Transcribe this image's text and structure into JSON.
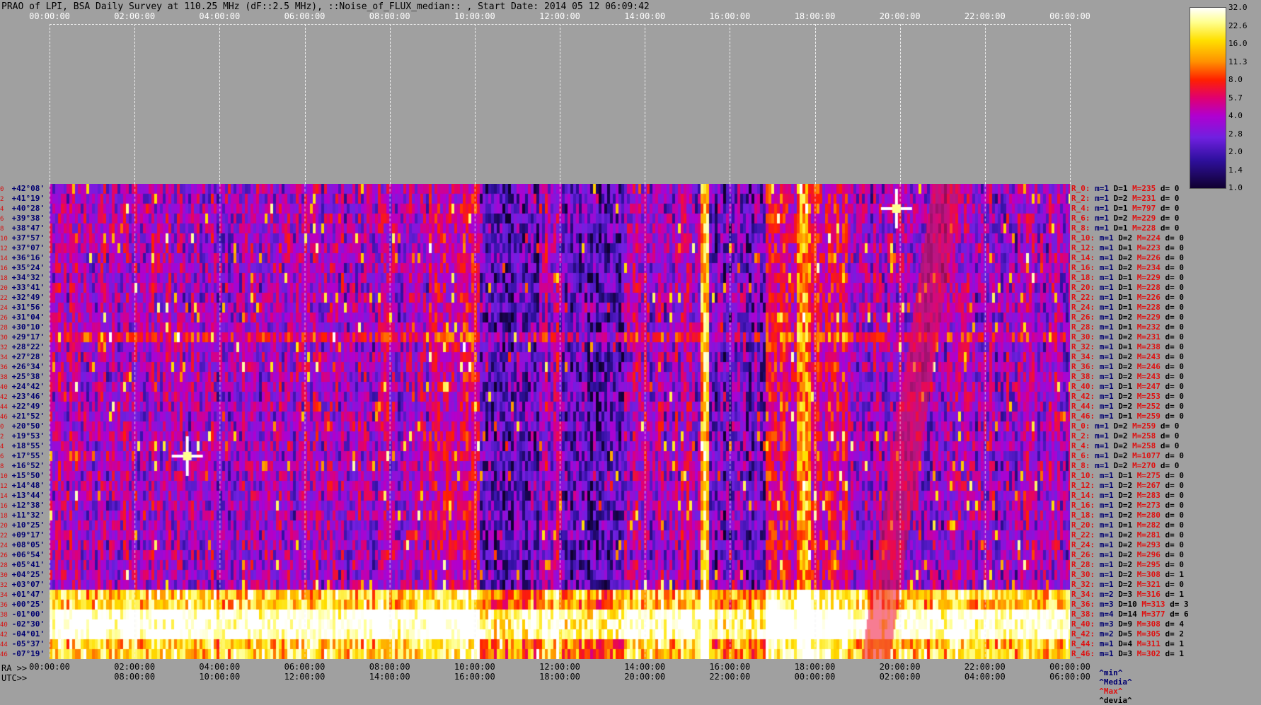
{
  "title": "PRAO of LPI, BSA Daily Survey at 110.25 MHz (dF::2.5 MHz), ::Noise_of_FLUX_median:: , Start Date: 2014 05 12 06:09:42",
  "utc_top_ticks": [
    "00:00:00",
    "02:00:00",
    "04:00:00",
    "06:00:00",
    "08:00:00",
    "10:00:00",
    "12:00:00",
    "14:00:00",
    "16:00:00",
    "18:00:00",
    "20:00:00",
    "22:00:00",
    "00:00:00"
  ],
  "ra_ticks": [
    "00:00:00",
    "02:00:00",
    "04:00:00",
    "06:00:00",
    "08:00:00",
    "10:00:00",
    "12:00:00",
    "14:00:00",
    "16:00:00",
    "18:00:00",
    "20:00:00",
    "22:00:00",
    "00:00:00"
  ],
  "utc_bottom_ticks": [
    "08:00:00",
    "10:00:00",
    "12:00:00",
    "14:00:00",
    "16:00:00",
    "18:00:00",
    "20:00:00",
    "22:00:00",
    "00:00:00",
    "02:00:00",
    "04:00:00",
    "06:00:00"
  ],
  "ra_label": "RA >>",
  "utc_label": "UTC>>",
  "legend_foot": {
    "min": "^min^",
    "media": "^Media^",
    "max": "^Max^",
    "devia": "^devia^"
  },
  "colorbar": {
    "labels": [
      "32.0",
      "22.6",
      "16.0",
      "11.3",
      "8.0",
      "5.7",
      "4.0",
      "2.8",
      "2.0",
      "1.4",
      "1.0"
    ],
    "colors": [
      "#ffffff",
      "#ffff90",
      "#ffe000",
      "#ff9000",
      "#ff2000",
      "#e00070",
      "#b000d0",
      "#7020e0",
      "#3010a0",
      "#100030"
    ]
  },
  "declinations": [
    {
      "i": "0",
      "d": "+42°08'"
    },
    {
      "i": "2",
      "d": "+41°19'"
    },
    {
      "i": "4",
      "d": "+40°28'"
    },
    {
      "i": "6",
      "d": "+39°38'"
    },
    {
      "i": "8",
      "d": "+38°47'"
    },
    {
      "i": "10",
      "d": "+37°57'"
    },
    {
      "i": "12",
      "d": "+37°07'"
    },
    {
      "i": "14",
      "d": "+36°16'"
    },
    {
      "i": "16",
      "d": "+35°24'"
    },
    {
      "i": "18",
      "d": "+34°32'"
    },
    {
      "i": "20",
      "d": "+33°41'"
    },
    {
      "i": "22",
      "d": "+32°49'"
    },
    {
      "i": "24",
      "d": "+31°56'"
    },
    {
      "i": "26",
      "d": "+31°04'"
    },
    {
      "i": "28",
      "d": "+30°10'"
    },
    {
      "i": "30",
      "d": "+29°17'"
    },
    {
      "i": "32",
      "d": "+28°22'"
    },
    {
      "i": "34",
      "d": "+27°28'"
    },
    {
      "i": "36",
      "d": "+26°34'"
    },
    {
      "i": "38",
      "d": "+25°38'"
    },
    {
      "i": "40",
      "d": "+24°42'"
    },
    {
      "i": "42",
      "d": "+23°46'"
    },
    {
      "i": "44",
      "d": "+22°49'"
    },
    {
      "i": "46",
      "d": "+21°52'"
    },
    {
      "i": "0",
      "d": "+20°50'"
    },
    {
      "i": "2",
      "d": "+19°53'"
    },
    {
      "i": "4",
      "d": "+18°55'"
    },
    {
      "i": "6",
      "d": "+17°55'"
    },
    {
      "i": "8",
      "d": "+16°52'"
    },
    {
      "i": "10",
      "d": "+15°50'"
    },
    {
      "i": "12",
      "d": "+14°48'"
    },
    {
      "i": "14",
      "d": "+13°44'"
    },
    {
      "i": "16",
      "d": "+12°38'"
    },
    {
      "i": "18",
      "d": "+11°32'"
    },
    {
      "i": "20",
      "d": "+10°25'"
    },
    {
      "i": "22",
      "d": "+09°17'"
    },
    {
      "i": "24",
      "d": "+08°05'"
    },
    {
      "i": "26",
      "d": "+06°54'"
    },
    {
      "i": "28",
      "d": "+05°41'"
    },
    {
      "i": "30",
      "d": "+04°25'"
    },
    {
      "i": "32",
      "d": "+03°07'"
    },
    {
      "i": "34",
      "d": "+01°47'"
    },
    {
      "i": "36",
      "d": "+00°25'"
    },
    {
      "i": "38",
      "d": "-01°00'"
    },
    {
      "i": "40",
      "d": "-02°30'"
    },
    {
      "i": "42",
      "d": "-04°01'"
    },
    {
      "i": "44",
      "d": "-05°37'"
    },
    {
      "i": "46",
      "d": "-07°19'"
    }
  ],
  "stats": [
    {
      "r": "R_0:",
      "m": "m=1",
      "D": "D=1",
      "M": "M=235",
      "d": "d= 0"
    },
    {
      "r": "R_2:",
      "m": "m=1",
      "D": "D=2",
      "M": "M=231",
      "d": "d= 0"
    },
    {
      "r": "R_4:",
      "m": "m=1",
      "D": "D=1",
      "M": "M=797",
      "d": "d= 0"
    },
    {
      "r": "R_6:",
      "m": "m=1",
      "D": "D=2",
      "M": "M=229",
      "d": "d= 0"
    },
    {
      "r": "R_8:",
      "m": "m=1",
      "D": "D=1",
      "M": "M=228",
      "d": "d= 0"
    },
    {
      "r": "R_10:",
      "m": "m=1",
      "D": "D=2",
      "M": "M=224",
      "d": "d= 0"
    },
    {
      "r": "R_12:",
      "m": "m=1",
      "D": "D=1",
      "M": "M=223",
      "d": "d= 0"
    },
    {
      "r": "R_14:",
      "m": "m=1",
      "D": "D=2",
      "M": "M=226",
      "d": "d= 0"
    },
    {
      "r": "R_16:",
      "m": "m=1",
      "D": "D=2",
      "M": "M=234",
      "d": "d= 0"
    },
    {
      "r": "R_18:",
      "m": "m=1",
      "D": "D=1",
      "M": "M=229",
      "d": "d= 0"
    },
    {
      "r": "R_20:",
      "m": "m=1",
      "D": "D=1",
      "M": "M=228",
      "d": "d= 0"
    },
    {
      "r": "R_22:",
      "m": "m=1",
      "D": "D=1",
      "M": "M=226",
      "d": "d= 0"
    },
    {
      "r": "R_24:",
      "m": "m=1",
      "D": "D=1",
      "M": "M=228",
      "d": "d= 0"
    },
    {
      "r": "R_26:",
      "m": "m=1",
      "D": "D=2",
      "M": "M=229",
      "d": "d= 0"
    },
    {
      "r": "R_28:",
      "m": "m=1",
      "D": "D=1",
      "M": "M=232",
      "d": "d= 0"
    },
    {
      "r": "R_30:",
      "m": "m=1",
      "D": "D=2",
      "M": "M=231",
      "d": "d= 0"
    },
    {
      "r": "R_32:",
      "m": "m=1",
      "D": "D=1",
      "M": "M=238",
      "d": "d= 0"
    },
    {
      "r": "R_34:",
      "m": "m=1",
      "D": "D=2",
      "M": "M=243",
      "d": "d= 0"
    },
    {
      "r": "R_36:",
      "m": "m=1",
      "D": "D=2",
      "M": "M=246",
      "d": "d= 0"
    },
    {
      "r": "R_38:",
      "m": "m=1",
      "D": "D=2",
      "M": "M=243",
      "d": "d= 0"
    },
    {
      "r": "R_40:",
      "m": "m=1",
      "D": "D=1",
      "M": "M=247",
      "d": "d= 0"
    },
    {
      "r": "R_42:",
      "m": "m=1",
      "D": "D=2",
      "M": "M=253",
      "d": "d= 0"
    },
    {
      "r": "R_44:",
      "m": "m=1",
      "D": "D=2",
      "M": "M=252",
      "d": "d= 0"
    },
    {
      "r": "R_46:",
      "m": "m=1",
      "D": "D=1",
      "M": "M=259",
      "d": "d= 0"
    },
    {
      "r": "R_0:",
      "m": "m=1",
      "D": "D=2",
      "M": "M=259",
      "d": "d= 0"
    },
    {
      "r": "R_2:",
      "m": "m=1",
      "D": "D=2",
      "M": "M=258",
      "d": "d= 0"
    },
    {
      "r": "R_4:",
      "m": "m=1",
      "D": "D=2",
      "M": "M=258",
      "d": "d= 0"
    },
    {
      "r": "R_6:",
      "m": "m=1",
      "D": "D=2",
      "M": "M=1077",
      "d": "d= 0"
    },
    {
      "r": "R_8:",
      "m": "m=1",
      "D": "D=2",
      "M": "M=270",
      "d": "d= 0"
    },
    {
      "r": "R_10:",
      "m": "m=1",
      "D": "D=1",
      "M": "M=275",
      "d": "d= 0"
    },
    {
      "r": "R_12:",
      "m": "m=1",
      "D": "D=2",
      "M": "M=267",
      "d": "d= 0"
    },
    {
      "r": "R_14:",
      "m": "m=1",
      "D": "D=2",
      "M": "M=283",
      "d": "d= 0"
    },
    {
      "r": "R_16:",
      "m": "m=1",
      "D": "D=2",
      "M": "M=273",
      "d": "d= 0"
    },
    {
      "r": "R_18:",
      "m": "m=1",
      "D": "D=2",
      "M": "M=280",
      "d": "d= 0"
    },
    {
      "r": "R_20:",
      "m": "m=1",
      "D": "D=1",
      "M": "M=282",
      "d": "d= 0"
    },
    {
      "r": "R_22:",
      "m": "m=1",
      "D": "D=2",
      "M": "M=281",
      "d": "d= 0"
    },
    {
      "r": "R_24:",
      "m": "m=1",
      "D": "D=2",
      "M": "M=293",
      "d": "d= 0"
    },
    {
      "r": "R_26:",
      "m": "m=1",
      "D": "D=2",
      "M": "M=296",
      "d": "d= 0"
    },
    {
      "r": "R_28:",
      "m": "m=1",
      "D": "D=2",
      "M": "M=295",
      "d": "d= 0"
    },
    {
      "r": "R_30:",
      "m": "m=1",
      "D": "D=2",
      "M": "M=308",
      "d": "d= 1"
    },
    {
      "r": "R_32:",
      "m": "m=1",
      "D": "D=2",
      "M": "M=321",
      "d": "d= 0"
    },
    {
      "r": "R_34:",
      "m": "m=2",
      "D": "D=3",
      "M": "M=316",
      "d": "d= 1"
    },
    {
      "r": "R_36:",
      "m": "m=3",
      "D": "D=10",
      "M": "M=313",
      "d": "d= 3"
    },
    {
      "r": "R_38:",
      "m": "m=4",
      "D": "D=14",
      "M": "M=377",
      "d": "d= 6"
    },
    {
      "r": "R_40:",
      "m": "m=3",
      "D": "D=9",
      "M": "M=308",
      "d": "d= 4"
    },
    {
      "r": "R_42:",
      "m": "m=2",
      "D": "D=5",
      "M": "M=305",
      "d": "d= 2"
    },
    {
      "r": "R_44:",
      "m": "m=1",
      "D": "D=4",
      "M": "M=311",
      "d": "d= 1"
    },
    {
      "r": "R_46:",
      "m": "m=1",
      "D": "D=3",
      "M": "M=302",
      "d": "d= 1"
    }
  ],
  "chart_data": {
    "type": "heatmap",
    "title": "PRAO of LPI, BSA Daily Survey at 110.25 MHz (dF::2.5 MHz), ::Noise_of_FLUX_median:: , Start Date: 2014 05 12 06:09:42",
    "xlabel": "RA / UTC",
    "ylabel": "",
    "x_range_ra": [
      "00:00:00",
      "24:00:00"
    ],
    "color_scale": "log",
    "color_range": [
      1.0,
      32.0
    ],
    "rows": 48,
    "features": [
      {
        "kind": "bright_band",
        "dec_from": "+01°47'",
        "dec_to": "-07°19'"
      },
      {
        "kind": "vertical_band",
        "ra": "15:30:00"
      },
      {
        "kind": "vertical_band",
        "ra": "17:50:00"
      },
      {
        "kind": "point_source",
        "ra": "03:10:00",
        "dec": "+17°55'"
      },
      {
        "kind": "point_source",
        "ra": "19:55:00",
        "dec": "+40°28'"
      },
      {
        "kind": "diagonal_feature",
        "ra_from": "19:00:00",
        "ra_to": "20:10:00"
      }
    ]
  }
}
